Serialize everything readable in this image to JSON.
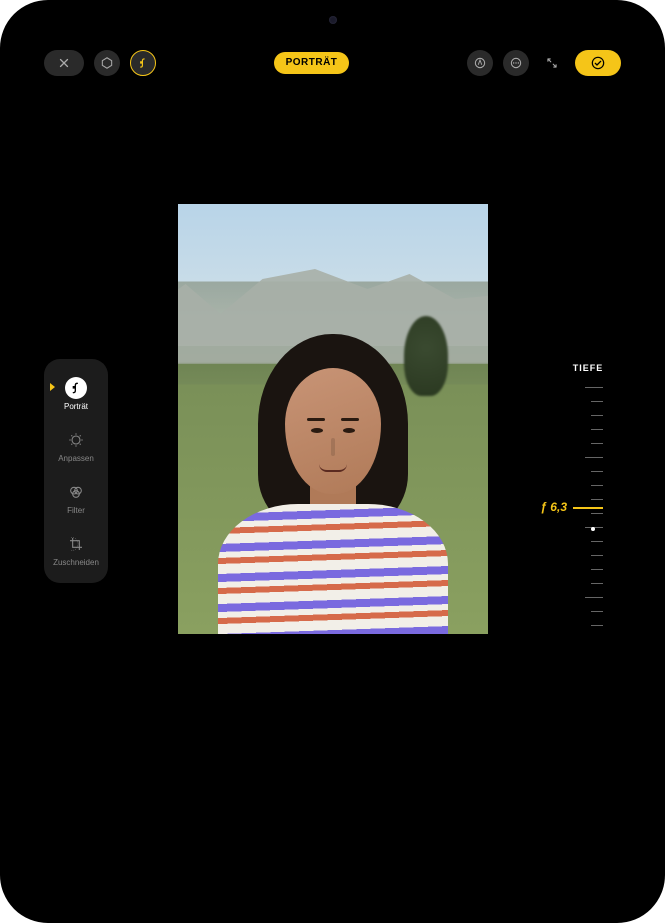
{
  "top": {
    "mode_label": "PORTRÄT"
  },
  "left_tools": {
    "items": [
      {
        "label": "Porträt"
      },
      {
        "label": "Anpassen"
      },
      {
        "label": "Filter"
      },
      {
        "label": "Zuschneiden"
      }
    ]
  },
  "depth": {
    "title": "TIEFE",
    "value_label": "ƒ 6,3"
  }
}
